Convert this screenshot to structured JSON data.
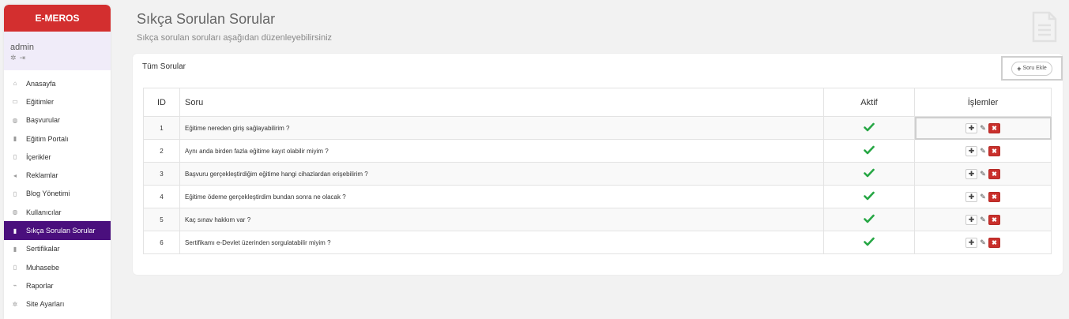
{
  "sidebar": {
    "brand": "E-MEROS",
    "user": {
      "name": "admin"
    },
    "items": [
      {
        "label": "Anasayfa",
        "icon": "home-icon",
        "glyph": "⌂",
        "active": false
      },
      {
        "label": "Eğitimler",
        "icon": "book-icon",
        "glyph": "▭",
        "active": false
      },
      {
        "label": "Başvurular",
        "icon": "users-icon",
        "glyph": "◍",
        "active": false
      },
      {
        "label": "Eğitim Portalı",
        "icon": "file-icon",
        "glyph": "▮",
        "active": false
      },
      {
        "label": "İçerikler",
        "icon": "document-icon",
        "glyph": "▯",
        "active": false
      },
      {
        "label": "Reklamlar",
        "icon": "bullhorn-icon",
        "glyph": "◂",
        "active": false
      },
      {
        "label": "Blog Yönetimi",
        "icon": "document-icon",
        "glyph": "▯",
        "active": false
      },
      {
        "label": "Kullanıcılar",
        "icon": "group-icon",
        "glyph": "◍",
        "active": false
      },
      {
        "label": "Sıkça Sorulan Sorular",
        "icon": "file-icon",
        "glyph": "▮",
        "active": true
      },
      {
        "label": "Sertifikalar",
        "icon": "certificate-icon",
        "glyph": "▮",
        "active": false
      },
      {
        "label": "Muhasebe",
        "icon": "document-icon",
        "glyph": "▯",
        "active": false
      },
      {
        "label": "Raporlar",
        "icon": "chart-line-icon",
        "glyph": "⌁",
        "active": false
      },
      {
        "label": "Site Ayarları",
        "icon": "gear-icon",
        "glyph": "✲",
        "active": false
      }
    ]
  },
  "header": {
    "title": "Sıkça Sorulan Sorular",
    "subtitle": "Sıkça sorulan soruları aşağıdan düzenleyebilirsiniz"
  },
  "card": {
    "title": "Tüm Sorular",
    "add_button_label": "Soru Ekle"
  },
  "table": {
    "columns": [
      "ID",
      "Soru",
      "Aktif",
      "İşlemler"
    ],
    "rows": [
      {
        "id": "1",
        "question": "Eğitime nereden giriş sağlayabilirim ?",
        "active": true
      },
      {
        "id": "2",
        "question": "Aynı anda birden fazla eğitime kayıt olabilir miyim ?",
        "active": true
      },
      {
        "id": "3",
        "question": "Başvuru gerçekleştirdiğim eğitime hangi cihazlardan erişebilirim ?",
        "active": true
      },
      {
        "id": "4",
        "question": "Eğitime ödeme gerçekleştirdim bundan sonra ne olacak ?",
        "active": true
      },
      {
        "id": "5",
        "question": "Kaç sınav hakkım var ?",
        "active": true
      },
      {
        "id": "6",
        "question": "Sertifikamı e-Devlet üzerinden sorgulatabilir miyim ?",
        "active": true
      }
    ]
  },
  "colors": {
    "brand": "#d32f2f",
    "active_nav": "#4a0f7d",
    "check": "#27a745",
    "delete": "#c9302c"
  }
}
